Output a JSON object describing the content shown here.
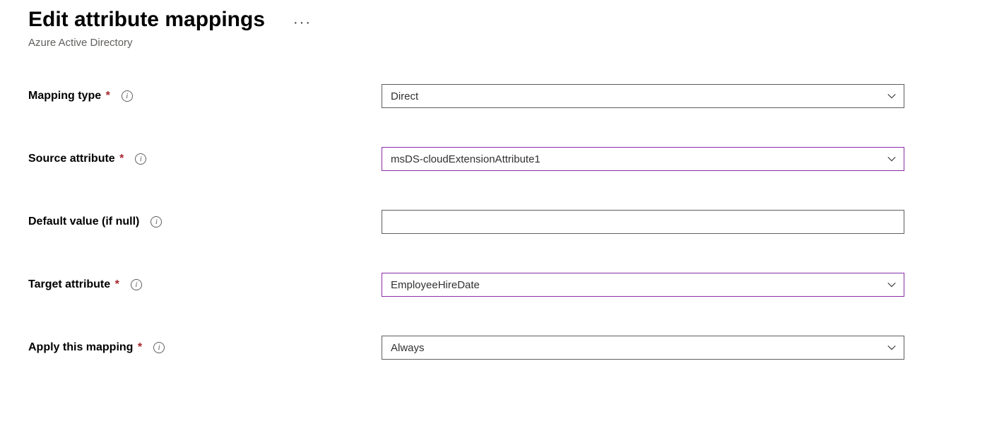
{
  "header": {
    "title": "Edit attribute mappings",
    "subtitle": "Azure Active Directory"
  },
  "fields": {
    "mapping_type": {
      "label": "Mapping type",
      "required": true,
      "value": "Direct"
    },
    "source_attribute": {
      "label": "Source attribute",
      "required": true,
      "value": "msDS-cloudExtensionAttribute1",
      "active": true
    },
    "default_value": {
      "label": "Default value (if null)",
      "required": false,
      "value": ""
    },
    "target_attribute": {
      "label": "Target attribute",
      "required": true,
      "value": "EmployeeHireDate",
      "active": true
    },
    "apply_mapping": {
      "label": "Apply this mapping",
      "required": true,
      "value": "Always"
    }
  }
}
